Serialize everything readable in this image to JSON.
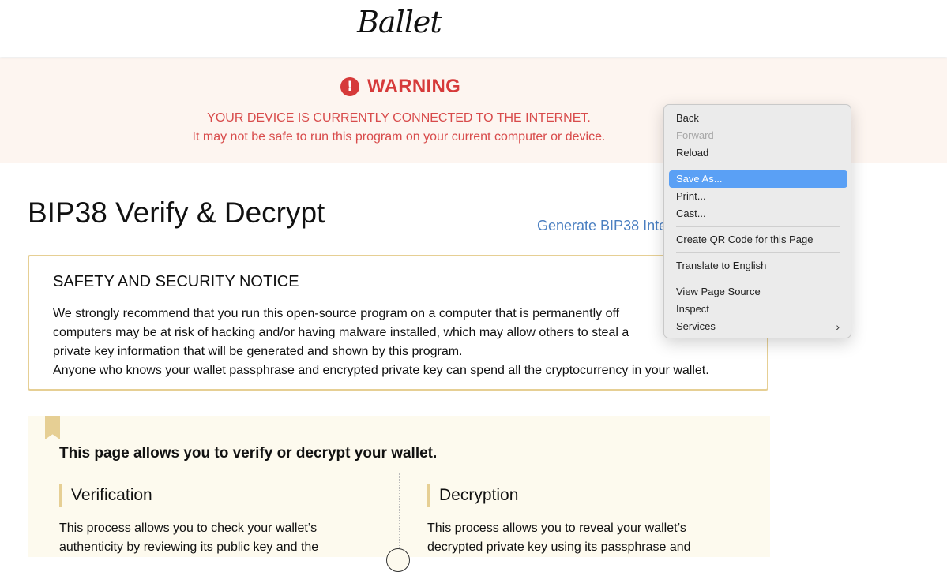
{
  "header": {
    "logo": "Ballet"
  },
  "warning": {
    "title": "WARNING",
    "line1": "YOUR DEVICE IS CURRENTLY CONNECTED TO THE INTERNET.",
    "line2": "It may not be safe to run this program on your current computer or device.",
    "icon": "exclamation-circle-icon",
    "color": "#d63a3a"
  },
  "main": {
    "title": "BIP38 Verify & Decrypt",
    "generate_link": "Generate BIP38 Inte"
  },
  "notice": {
    "title": "SAFETY AND SECURITY NOTICE",
    "line1": "We strongly recommend that you run this open-source program on a computer that is permanently off",
    "line2": "computers may be at risk of hacking and/or having malware installed, which may allow others to steal a",
    "line3": "private key information that will be generated and shown by this program.",
    "line4": "Anyone who knows your wallet passphrase and encrypted private key can spend all the cryptocurrency in your wallet."
  },
  "info": {
    "heading": "This page allows you to verify or decrypt your wallet.",
    "verification": {
      "title": "Verification",
      "line1": "This process allows you to check your wallet’s",
      "line2": "authenticity by reviewing its public key and the"
    },
    "decryption": {
      "title": "Decryption",
      "line1": "This process allows you to reveal your wallet’s",
      "line2": "decrypted private key using its passphrase and"
    }
  },
  "context_menu": {
    "items": {
      "back": "Back",
      "forward": "Forward",
      "reload": "Reload",
      "save_as": "Save As...",
      "print": "Print...",
      "cast": "Cast...",
      "qr": "Create QR Code for this Page",
      "translate": "Translate to English",
      "view_source": "View Page Source",
      "inspect": "Inspect",
      "services": "Services"
    },
    "highlight_color": "#5aa0f5"
  },
  "colors": {
    "accent_gold": "#e6cf94",
    "link_blue": "#4a7fc1",
    "warning_bg": "#fdf5f0"
  }
}
